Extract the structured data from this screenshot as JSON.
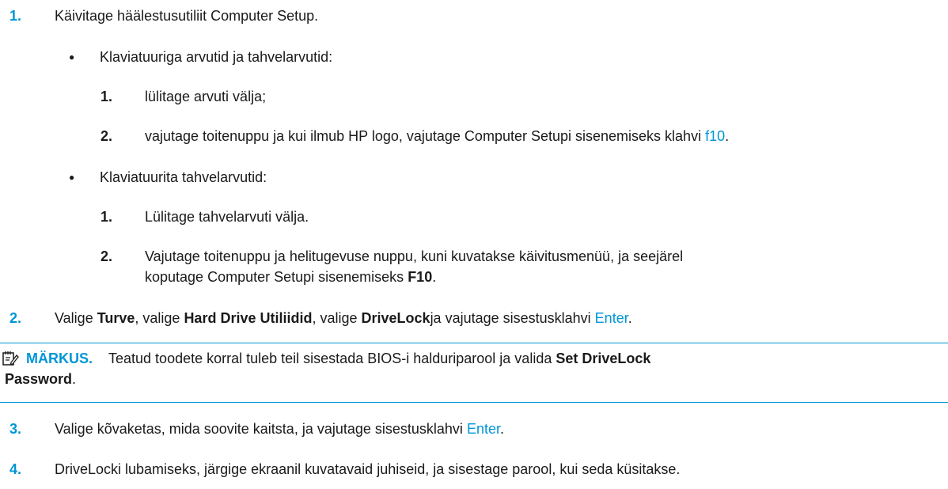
{
  "step1": {
    "num": "1.",
    "text": "Käivitage häälestusutiliit Computer Setup.",
    "keyboard": {
      "heading": "Klaviatuuriga arvutid ja tahvelarvutid:",
      "s1_num": "1.",
      "s1_text": "lülitage arvuti välja;",
      "s2_num": "2.",
      "s2_text": "vajutage toitenuppu ja kui ilmub HP logo, vajutage Computer Setupi sisenemiseks klahvi ",
      "s2_key": "f10",
      "s2_end": "."
    },
    "tablet": {
      "heading": "Klaviatuurita tahvelarvutid:",
      "s1_num": "1.",
      "s1_text": "Lülitage tahvelarvuti välja.",
      "s2_num": "2.",
      "s2_line1": "Vajutage toitenuppu ja helitugevuse nuppu, kuni kuvatakse käivitusmenüü, ja seejärel",
      "s2_line2_pre": "koputage Computer Setupi sisenemiseks ",
      "s2_key": "F10",
      "s2_end": "."
    }
  },
  "step2": {
    "num": "2.",
    "t1": "Valige ",
    "b1": "Turve",
    "t2": ", valige ",
    "b2": "Hard Drive Utiliidid",
    "t3": ", valige ",
    "b3": "DriveLock",
    "t4": "ja vajutage sisestusklahvi ",
    "key": "Enter",
    "end": "."
  },
  "note": {
    "icon": "note-pad-pencil-icon",
    "label": "MÄRKUS.",
    "text": "Teatud toodete korral tuleb teil sisestada BIOS-i halduriparool ja valida ",
    "bold1": "Set DriveLock",
    "bold2": "Password",
    "end": "."
  },
  "step3": {
    "num": "3.",
    "text": "Valige kõvaketas, mida soovite kaitsta, ja vajutage sisestusklahvi ",
    "key": "Enter",
    "end": "."
  },
  "step4": {
    "num": "4.",
    "text": "DriveLocki lubamiseks, järgige ekraanil kuvatavaid juhiseid, ja sisestage parool, kui seda küsitakse."
  },
  "colors": {
    "accent": "#0096d6",
    "text": "#1a1a1a"
  }
}
